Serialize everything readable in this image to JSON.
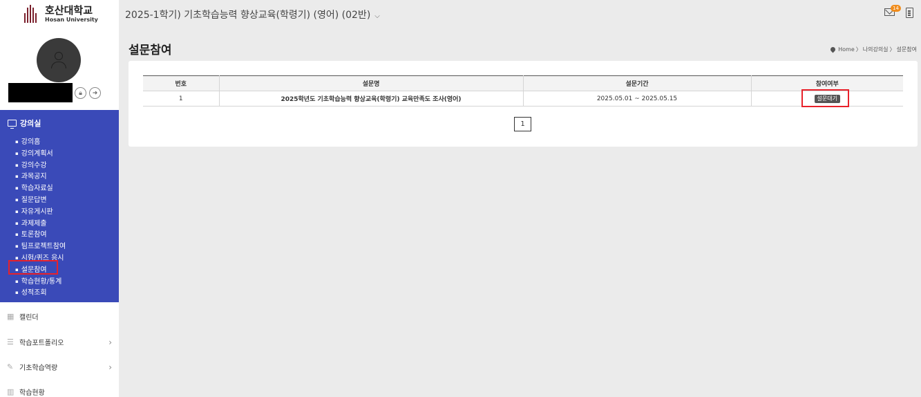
{
  "logo": {
    "korean": "호산대학교",
    "english": "Hosan University"
  },
  "header": {
    "course_title": "2025-1학기) 기초학습능력 향상교육(학령기) (영어) (02반)",
    "mail_count": "14"
  },
  "sidebar": {
    "section_title": "강의실",
    "sub_items": [
      "강의홈",
      "강의계획서",
      "강의수강",
      "과목공지",
      "학습자료실",
      "질문답변",
      "자유게시판",
      "과제제출",
      "토론참여",
      "팀프로젝트참여",
      "시험/퀴즈 응시",
      "설문참여",
      "학습현황/통계",
      "성적조회"
    ],
    "menus": [
      {
        "label": "캘린더",
        "icon": "calendar-icon"
      },
      {
        "label": "학습포트폴리오",
        "icon": "list-icon"
      },
      {
        "label": "기초학습역량",
        "icon": "edit-icon"
      },
      {
        "label": "학습현황",
        "icon": "bar-chart-icon"
      }
    ]
  },
  "page": {
    "title": "설문참여"
  },
  "breadcrumb": {
    "home": "Home",
    "level1": "나의강의실",
    "current": "설문참여"
  },
  "table": {
    "headers": [
      "번호",
      "설문명",
      "설문기간",
      "참여여부"
    ],
    "rows": [
      {
        "no": "1",
        "name": "2025학년도 기초학습능력 향상교육(학령기) 교육만족도 조사(영어)",
        "period": "2025.05.01 ~ 2025.05.15",
        "status": "설문대기"
      }
    ]
  },
  "pagination": {
    "current": "1"
  },
  "colors": {
    "sidebar_active": "#3a4ab8",
    "highlight": "#e8212a",
    "badge": "#f08c1c"
  }
}
